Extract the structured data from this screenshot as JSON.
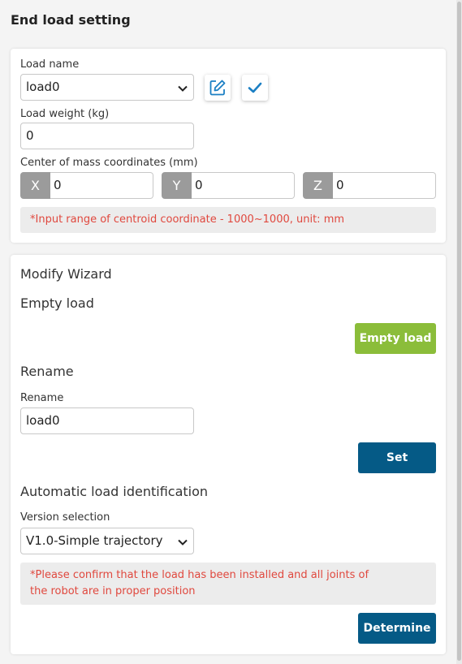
{
  "page": {
    "title": "End load setting"
  },
  "load_card": {
    "load_name_label": "Load name",
    "load_name_value": "load0",
    "edit_icon": "edit-icon",
    "confirm_icon": "check-icon",
    "load_weight_label": "Load weight (kg)",
    "load_weight_value": "0",
    "com_label": "Center of mass coordinates  (mm)",
    "x_tag": "X",
    "x_value": "0",
    "y_tag": "Y",
    "y_value": "0",
    "z_tag": "Z",
    "z_value": "0",
    "range_note": "*Input range of centroid coordinate - 1000~1000, unit: mm"
  },
  "wizard_card": {
    "title": "Modify Wizard",
    "empty_load_heading": "Empty load",
    "empty_load_button": "Empty load",
    "rename_heading": "Rename",
    "rename_label": "Rename",
    "rename_value": "load0",
    "set_button": "Set",
    "auto_heading": "Automatic load identification",
    "version_label": "Version selection",
    "version_value": "V1.0-Simple trajectory",
    "confirm_note_line1": "*Please confirm that the load has been installed and all joints of",
    "confirm_note_line2": "the robot are in proper position",
    "determine_button": "Determine"
  },
  "colors": {
    "accent_blue": "#055a86",
    "accent_green": "#8bbd3a",
    "warning_red": "#e0483e",
    "icon_blue": "#1b7fc4"
  }
}
